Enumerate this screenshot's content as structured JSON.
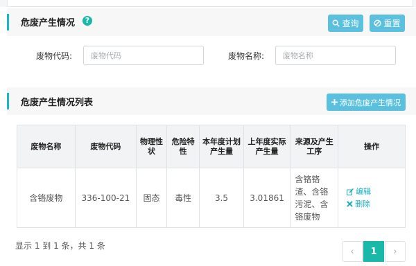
{
  "search_section": {
    "title": "危废产生情况",
    "query_button": "查询",
    "reset_button": "重置",
    "fields": {
      "code_label": "废物代码:",
      "code_placeholder": "废物代码",
      "name_label": "废物名称:",
      "name_placeholder": "废物名称"
    }
  },
  "list_section": {
    "title": "危废产生情况列表",
    "add_button": "添加危废产生情况"
  },
  "table": {
    "headers": [
      "废物名称",
      "废物代码",
      "物理性状",
      "危险特性",
      "本年度计划产生量",
      "上年度实际产生量",
      "来源及产生工序",
      "操作"
    ],
    "rows": [
      {
        "name": "含铬废物",
        "code": "336-100-21",
        "physical_state": "固态",
        "hazard": "毒性",
        "planned": "3.5",
        "actual": "3.01861",
        "source": "含铬铬渣、含铬污泥、含铬废物",
        "edit": "编辑",
        "delete": "删除"
      }
    ]
  },
  "pagination": {
    "summary": "显示 1 到 1 条，共 1 条",
    "prev": "‹",
    "current": "1",
    "next": "›"
  },
  "colors": {
    "accent": "#1cb7c4",
    "button": "#5bc0de",
    "page_active": "#18b9a8",
    "link": "#1ab0c0"
  },
  "icons": [
    "help-icon",
    "search-icon",
    "reset-icon",
    "plus-icon",
    "edit-icon",
    "delete-icon"
  ]
}
